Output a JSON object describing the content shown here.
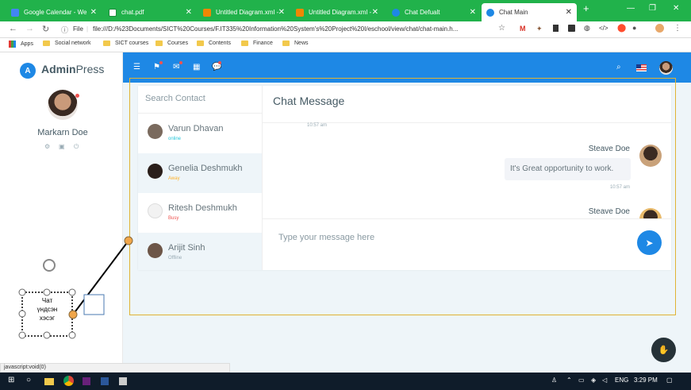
{
  "browser": {
    "tabs": [
      {
        "title": "Google Calendar - We",
        "icon": "calendar-icon",
        "active": false
      },
      {
        "title": "chat.pdf",
        "icon": "pdf-icon",
        "active": false
      },
      {
        "title": "Untitled Diagram.xml -",
        "icon": "drawio-icon",
        "active": false
      },
      {
        "title": "Untitled Diagram.xml -",
        "icon": "drawio-icon",
        "active": false
      },
      {
        "title": "Chat Defualt",
        "icon": "globe-icon",
        "active": false
      },
      {
        "title": "Chat Main",
        "icon": "globe-icon",
        "active": true
      }
    ],
    "address": "file:///D:/%23Documents/SICT%20Courses/F.IT335%20Information%20System's%20Project%20I/eschool/view/chat/chat-main.h...",
    "file_label": "File",
    "bookmarks": [
      "Apps",
      "Social network",
      "SICT courses",
      "Courses",
      "Contents",
      "Finance",
      "News"
    ],
    "status_url": "javascript:void(0)"
  },
  "sidebar": {
    "logo_bold": "Admin",
    "logo_light": "Press",
    "user_name": "Markarn Doe"
  },
  "chat": {
    "search_placeholder": "Search Contact",
    "panel_title": "Chat Message",
    "contacts": [
      {
        "name": "Varun Dhavan",
        "status": "online",
        "status_color": "#26c6da"
      },
      {
        "name": "Genelia Deshmukh",
        "status": "Away",
        "status_color": "#ffb22b"
      },
      {
        "name": "Ritesh Deshmukh",
        "status": "Busy",
        "status_color": "#ef5350"
      },
      {
        "name": "Arijit Sinh",
        "status": "Offline",
        "status_color": "#99abb4"
      }
    ],
    "messages": [
      {
        "time": "10:57 am"
      },
      {
        "sender": "Steave Doe",
        "text": "It's Great opportunity to work.",
        "time": "10:57 am"
      },
      {
        "sender": "Steave Doe"
      }
    ],
    "input_placeholder": "Type your message here"
  },
  "diagram": {
    "shape_text_lines": [
      "Чат",
      "үндсэн",
      "хэсэг"
    ]
  },
  "taskbar": {
    "lang": "ENG",
    "time": "3:29 PM"
  },
  "colors": {
    "chrome_green": "#21b24b",
    "header_blue": "#1e88e5",
    "selection_yellow": "#e0b334"
  }
}
